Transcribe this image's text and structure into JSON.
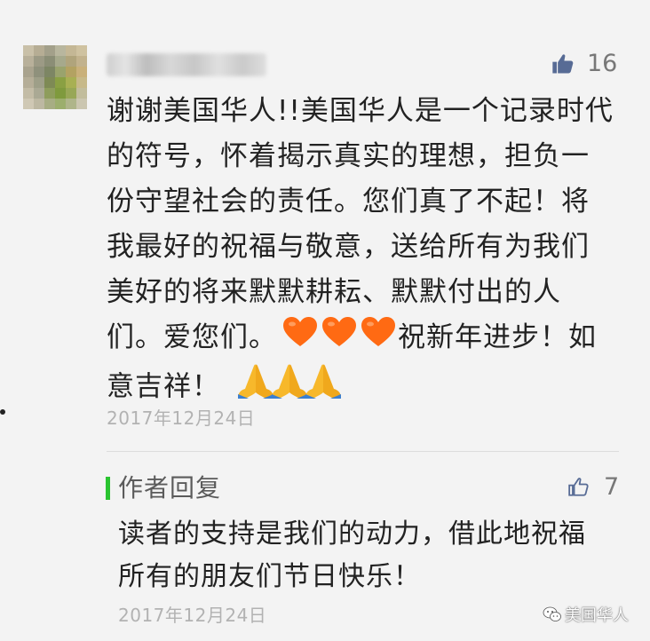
{
  "comment": {
    "like_count": "16",
    "lines": [
      "谢谢美国华人!!美国华人是一个记录时代",
      "的符号，怀着揭示真实的理想，担负一",
      "份守望社会的责任。您们真了不起！将",
      "我最好的祝福与敬意，送给所有为我们",
      "美好的将来默默耕耘、默默付出的人",
      "们。爱您们。",
      "祝新年进步！如",
      "意吉祥！"
    ],
    "emojis": {
      "hearts": [
        "orange-heart-icon",
        "orange-heart-icon",
        "orange-heart-icon"
      ],
      "hands": [
        "folded-hands-icon",
        "folded-hands-icon",
        "folded-hands-icon"
      ]
    },
    "date": "2017年12月24日"
  },
  "reply": {
    "label": "作者回复",
    "like_count": "7",
    "lines": [
      "读者的支持是我们的动力，借此地祝福",
      "所有的朋友们节日快乐！"
    ],
    "date": "2017年12月24日"
  },
  "watermark": {
    "text": "美国华人",
    "icon": "wechat-icon"
  },
  "colors": {
    "background": "#f3f3f3",
    "accent_bar": "#2ac430",
    "meta_text": "#b2b2b2",
    "like_icon": "#576b95",
    "heart": "#ff6a13",
    "hands": "#f7b82b"
  }
}
